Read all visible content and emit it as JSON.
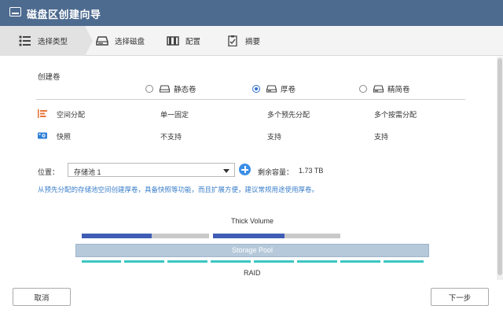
{
  "window": {
    "title": "磁盘区创建向导"
  },
  "steps": [
    {
      "label": "选择类型",
      "icon": "list-icon",
      "active": true
    },
    {
      "label": "选择磁盘",
      "icon": "disk-icon",
      "active": false
    },
    {
      "label": "配置",
      "icon": "config-icon",
      "active": false
    },
    {
      "label": "摘要",
      "icon": "summary-icon",
      "active": false
    }
  ],
  "create": {
    "title": "创建卷",
    "options": [
      {
        "label": "静态卷",
        "checked": false
      },
      {
        "label": "厚卷",
        "checked": true
      },
      {
        "label": "精简卷",
        "checked": false
      }
    ],
    "rows": [
      {
        "label": "空间分配",
        "icon": "allocation-icon",
        "values": [
          "单一固定",
          "多个预先分配",
          "多个按需分配"
        ]
      },
      {
        "label": "快照",
        "icon": "snapshot-icon",
        "values": [
          "不支持",
          "支持",
          "支持"
        ]
      }
    ]
  },
  "location": {
    "label": "位置：",
    "selected": "存储池 1",
    "remaining_label": "剩余容量：",
    "remaining_value": "1.73 TB"
  },
  "info_text": "从预先分配的存储池空间创建厚卷，具备快照等功能，而且扩展方便，建议常规用途使用厚卷。",
  "diagram": {
    "volume_title": "Thick Volume",
    "pool_label": "Storage Pool",
    "raid_label": "RAID",
    "volume_fill": [
      0.55,
      0.56
    ],
    "colors": {
      "used": "#3f5db5",
      "free": "#c9c9c9",
      "raid": "#3cc6c2",
      "pool": "#b6c9da"
    }
  },
  "buttons": {
    "cancel": "取消",
    "next": "下一步"
  },
  "colors": {
    "titlebar": "#4d6a8f",
    "accent": "#2f6fd0",
    "info": "#3a7ec9"
  }
}
